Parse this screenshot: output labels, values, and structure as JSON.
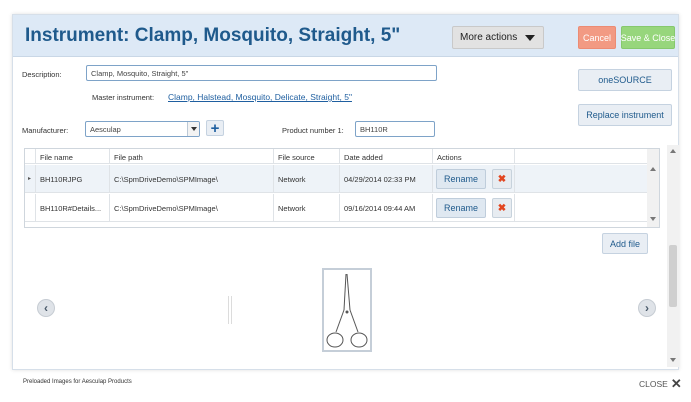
{
  "header": {
    "title": "Instrument: Clamp, Mosquito, Straight, 5\"",
    "more_actions_label": "More actions",
    "cancel_label": "Cancel",
    "save_close_label": "Save & Close"
  },
  "form": {
    "description_label": "Description:",
    "description_value": "Clamp, Mosquito, Straight, 5\"",
    "master_instrument_label": "Master instrument:",
    "master_instrument_value": "Clamp, Halstead, Mosquito, Delicate, Straight, 5\"",
    "manufacturer_label": "Manufacturer:",
    "manufacturer_value": "Aesculap",
    "add_manufacturer_symbol": "+",
    "product_number_label": "Product number 1:",
    "product_number_value": "BH110R"
  },
  "side_buttons": {
    "onesource_label": "oneSOURCE",
    "replace_instrument_label": "Replace instrument"
  },
  "files_grid": {
    "columns": [
      "File name",
      "File path",
      "File source",
      "Date added",
      "Actions"
    ],
    "rows": [
      {
        "file_name": "BH110RJPG",
        "file_path": "C:\\SpmDriveDemo\\SPMImage\\",
        "file_source": "Network",
        "date_added": "04/29/2014 02:33 PM",
        "rename_label": "Rename",
        "delete_symbol": "✖"
      },
      {
        "file_name": "BH110R#Details...",
        "file_path": "C:\\SpmDriveDemo\\SPMImage\\",
        "file_source": "Network",
        "date_added": "09/16/2014 09:44 AM",
        "rename_label": "Rename",
        "delete_symbol": "✖"
      }
    ],
    "add_file_label": "Add file"
  },
  "gallery": {
    "prev_symbol": "‹",
    "next_symbol": "›"
  },
  "footer": {
    "preloaded_text": "Preloaded Images for Aesculap Products",
    "close_label": "CLOSE",
    "close_symbol": "✕"
  },
  "colors": {
    "header_bg": "#dde9f6",
    "title": "#1f5a8c",
    "cancel": "#f29a83",
    "save": "#97d67c",
    "delete": "#e2451f"
  }
}
